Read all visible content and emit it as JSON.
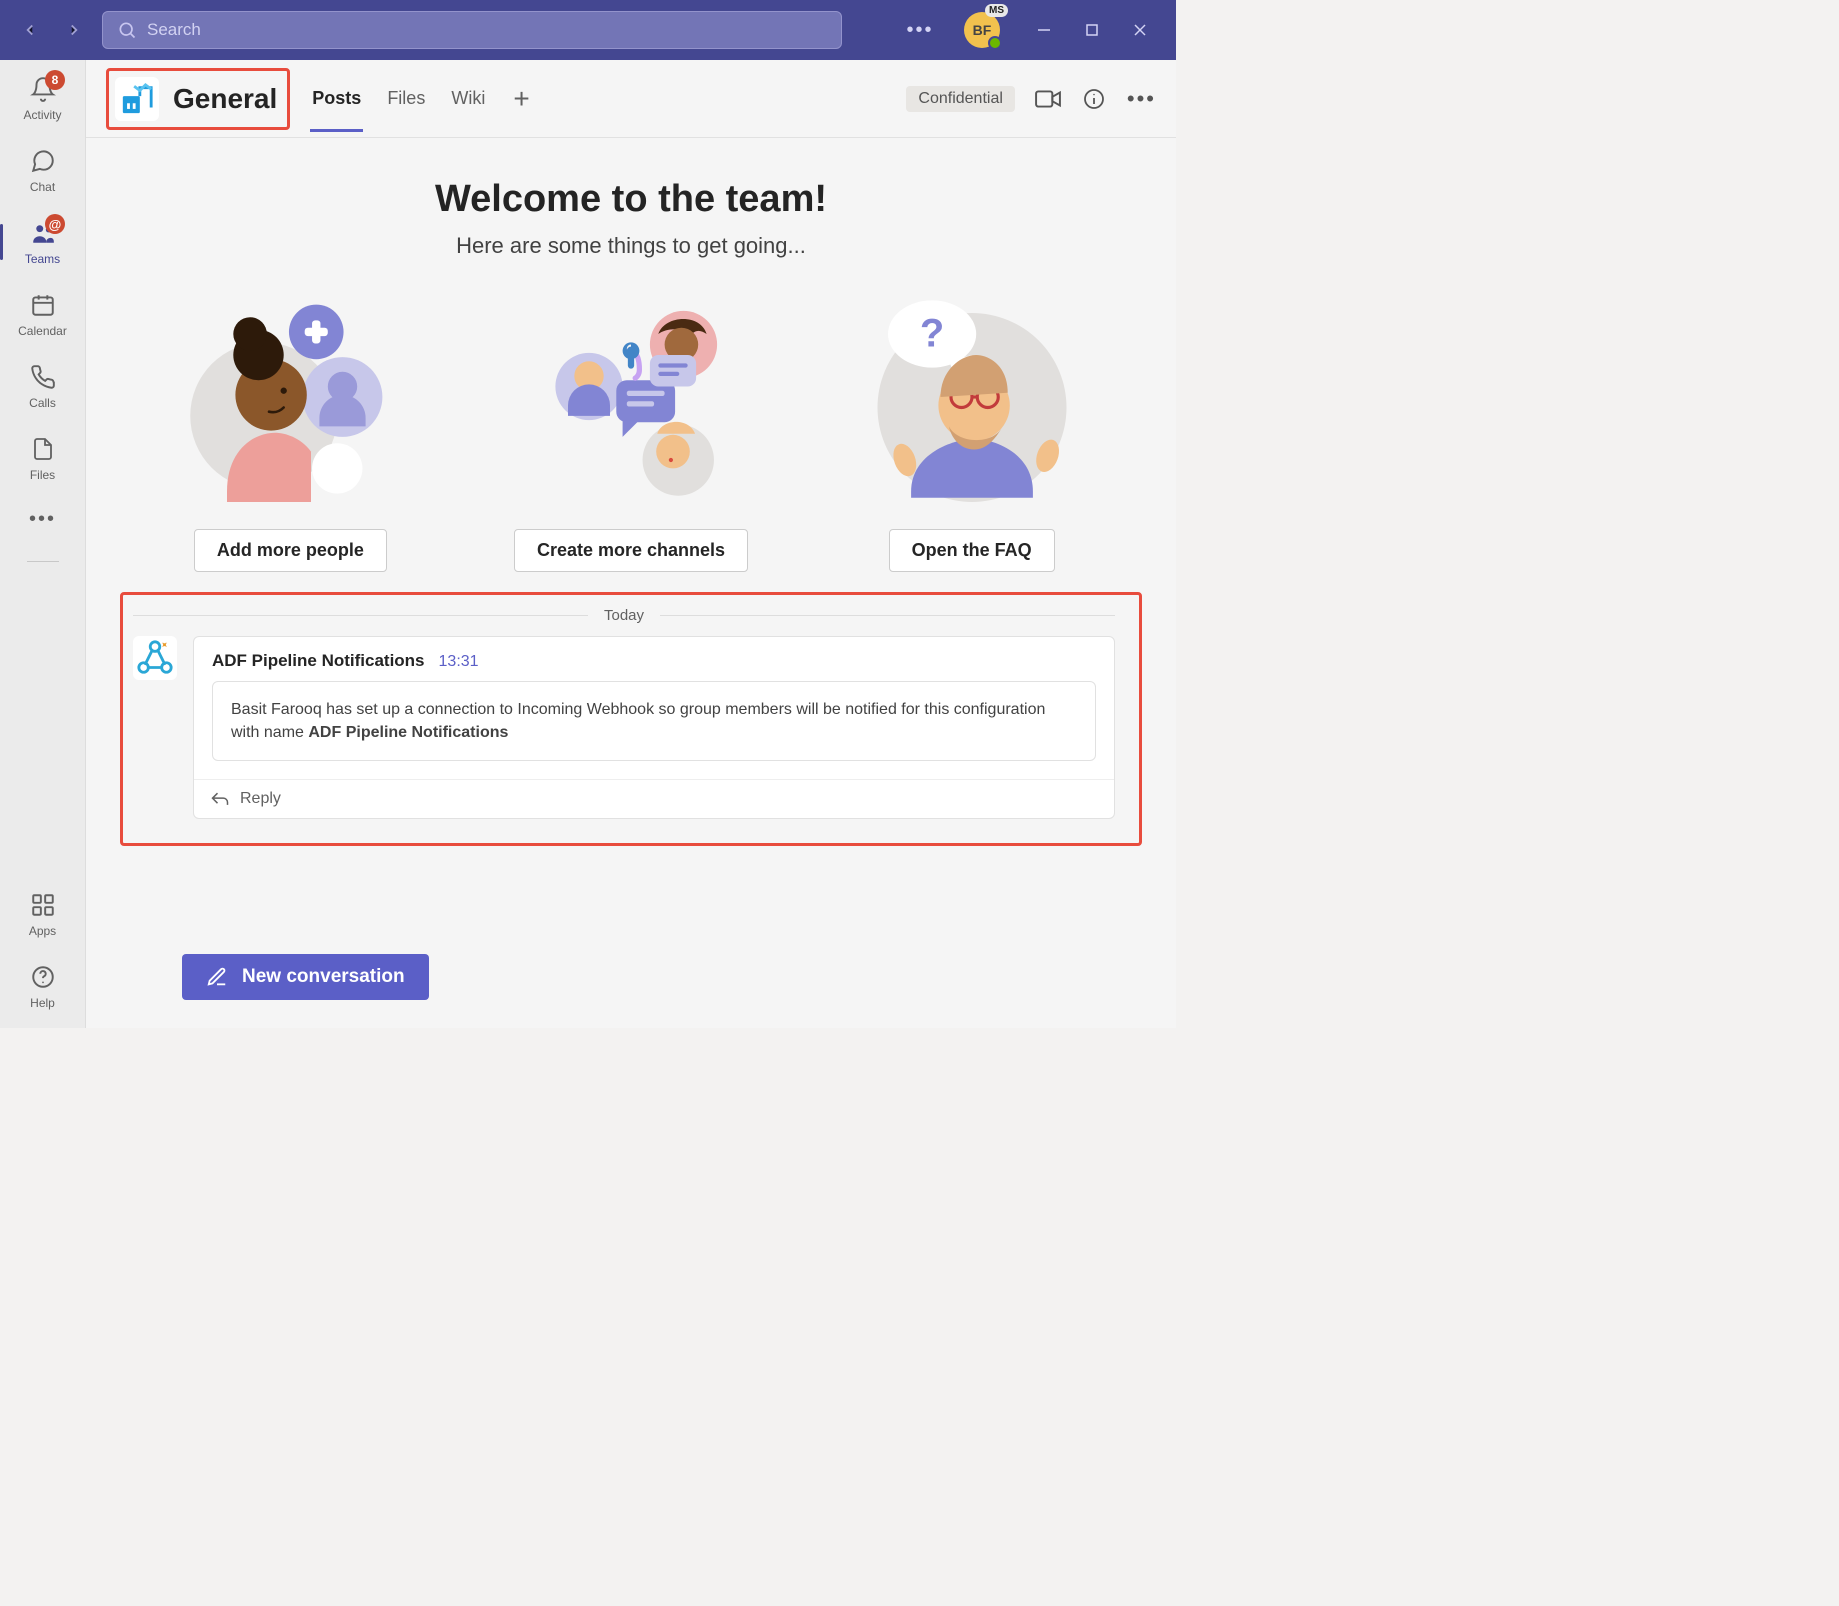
{
  "search": {
    "placeholder": "Search"
  },
  "avatar": {
    "initials": "BF",
    "ms_label": "MS"
  },
  "rail": {
    "activity": {
      "label": "Activity",
      "badge": "8"
    },
    "chat": {
      "label": "Chat"
    },
    "teams": {
      "label": "Teams",
      "at_badge": "@"
    },
    "calendar": {
      "label": "Calendar"
    },
    "calls": {
      "label": "Calls"
    },
    "files": {
      "label": "Files"
    },
    "apps": {
      "label": "Apps"
    },
    "help": {
      "label": "Help"
    }
  },
  "channel": {
    "name": "General",
    "tabs": {
      "posts": "Posts",
      "files": "Files",
      "wiki": "Wiki"
    },
    "confidential": "Confidential"
  },
  "welcome": {
    "title": "Welcome to the team!",
    "subtitle": "Here are some things to get going...",
    "card1_btn": "Add more people",
    "card2_btn": "Create more channels",
    "card3_btn": "Open the FAQ"
  },
  "feed": {
    "date_label": "Today",
    "message": {
      "author": "ADF Pipeline Notifications",
      "time": "13:31",
      "body_prefix": "Basit Farooq has set up a connection to Incoming Webhook so group members will be notified for this configuration with name ",
      "body_bold": "ADF Pipeline Notifications"
    },
    "reply_label": "Reply"
  },
  "compose": {
    "label": "New conversation"
  }
}
